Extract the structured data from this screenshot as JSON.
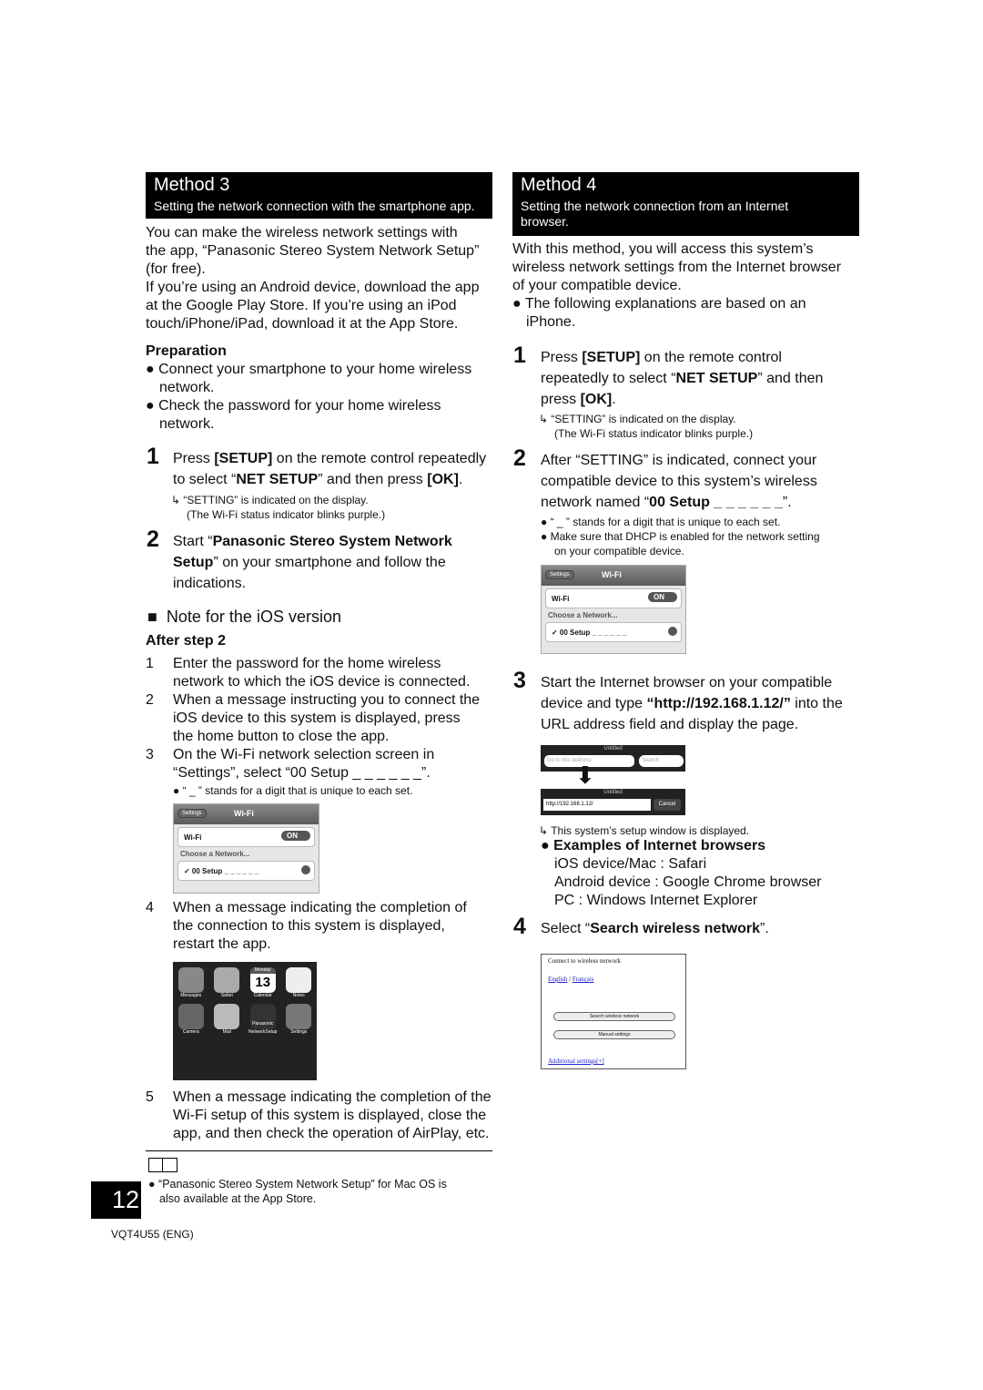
{
  "left": {
    "header": {
      "title": "Method 3",
      "subtitle": "Setting the network connection with the smartphone app."
    },
    "intro": [
      "You can make the wireless network settings with",
      "the app, “Panasonic Stereo System Network Setup”",
      "(for free).",
      "If you’re using an Android device, download the app",
      "at the Google Play Store. If you’re using an iPod",
      "touch/iPhone/iPad, download it at the App Store."
    ],
    "preparation": {
      "title": "Preparation",
      "bullets": [
        [
          "Connect your smartphone to your home wireless",
          "network."
        ],
        [
          "Check the password for your home wireless",
          "network."
        ]
      ]
    },
    "step1": {
      "num": "1",
      "a": "Press ",
      "b": "[SETUP]",
      "c": " on the remote control repeatedly",
      "d": "to select “",
      "e": "NET SETUP",
      "f": "” and then press ",
      "g": "[OK]",
      "h": ".",
      "note1": "“SETTING” is indicated on the display.",
      "note2": "(The Wi-Fi status indicator blinks purple.)"
    },
    "step2": {
      "num": "2",
      "a": "Start “",
      "b": "Panasonic Stereo System Network",
      "c": "Setup",
      "d": "” on your smartphone and follow the",
      "e": "indications."
    },
    "ios": {
      "title": "Note for the iOS version",
      "after": "After step 2",
      "items": [
        {
          "n": "1",
          "lines": [
            "Enter the password for the home wireless",
            "network to which the iOS device is connected."
          ]
        },
        {
          "n": "2",
          "lines": [
            "When a message instructing you to connect the",
            "iOS device to this system is displayed, press",
            "the home button to close the app."
          ]
        },
        {
          "n": "3",
          "lines": [
            "On the Wi-Fi network selection screen in",
            "“Settings”, select “00 Setup _ _ _ _ _ _”."
          ]
        },
        {
          "n": "4",
          "lines": [
            "When a message indicating the completion of",
            "the connection to this system is displayed,",
            "restart the app."
          ]
        },
        {
          "n": "5",
          "lines": [
            "When a message indicating the completion of the",
            "Wi-Fi setup of this system is displayed, close the",
            "app, and then check the operation of AirPlay, etc."
          ]
        }
      ],
      "digit_note": "“ _ ” stands for a digit that is unique to each set."
    },
    "wifi_shot": {
      "back": "Settings",
      "title": "Wi-Fi",
      "wifi": "Wi-Fi",
      "on": "ON",
      "choose": "Choose a Network...",
      "network": "✓ 00 Setup _ _ _ _ _ _"
    },
    "home_shot": {
      "apps": [
        "Messages",
        "Safari",
        "Calendar",
        "Notes",
        "Camera",
        "Mail",
        "NetworkSetup",
        "Settings"
      ],
      "day": "Monday",
      "date": "13",
      "brand": "Panasonic"
    },
    "footnote": [
      "“Panasonic Stereo System Network Setup” for Mac OS is",
      "also available at the App Store."
    ]
  },
  "right": {
    "header": {
      "title": "Method 4",
      "subtitle": [
        "Setting the network connection from an Internet",
        "browser."
      ]
    },
    "intro": [
      "With this method, you will access this system’s",
      "wireless network settings from the Internet browser",
      "of your compatible device."
    ],
    "intro_bullet": [
      "The following explanations are based on an",
      "iPhone."
    ],
    "step1": {
      "num": "1",
      "a": "Press ",
      "b": "[SETUP]",
      "c": " on the remote control",
      "d": "repeatedly to select “",
      "e": "NET SETUP",
      "f": "” and then",
      "g": "press ",
      "h": "[OK]",
      "i": ".",
      "note1": "“SETTING” is indicated on the display.",
      "note2": "(The Wi-Fi status indicator blinks purple.)"
    },
    "step2": {
      "num": "2",
      "l1": "After “SETTING” is indicated, connect your",
      "l2": "compatible device to this system’s wireless",
      "l3a": "network named “",
      "l3b": "00 Setup _ _ _ _ _ _",
      "l3c": "”.",
      "b1": "“ _ ” stands for a digit that is unique to each set.",
      "b2": [
        "Make sure that DHCP is enabled for the network setting",
        "on your compatible device."
      ]
    },
    "step3": {
      "num": "3",
      "l1": "Start the Internet browser on your compatible",
      "l2a": "device and type ",
      "l2b": "“http://192.168.1.12/”",
      "l2c": " into the",
      "l3": "URL address field and display the page.",
      "note": "This system’s setup window is displayed.",
      "examples_title": "Examples of Internet browsers",
      "examples": [
        "iOS device/Mac : Safari",
        "Android device : Google Chrome browser",
        "PC : Windows Internet Explorer"
      ]
    },
    "browser_shot": {
      "title": "Untitled",
      "address_placeholder": "Go to this address",
      "search": "Search",
      "url": "http://192.168.1.12/",
      "cancel": "Cancel"
    },
    "step4": {
      "num": "4",
      "a": "Select “",
      "b": "Search wireless network",
      "c": "”."
    },
    "setup_shot": {
      "title": "Connect to wireless network",
      "english": "English",
      "sep": " / ",
      "french": "Français",
      "search_btn": "Search wireless network",
      "manual_btn": "Manual settings",
      "additional": "Additional settings[+]"
    }
  },
  "page_number": "12",
  "doc_code": "VQT4U55 (ENG)"
}
